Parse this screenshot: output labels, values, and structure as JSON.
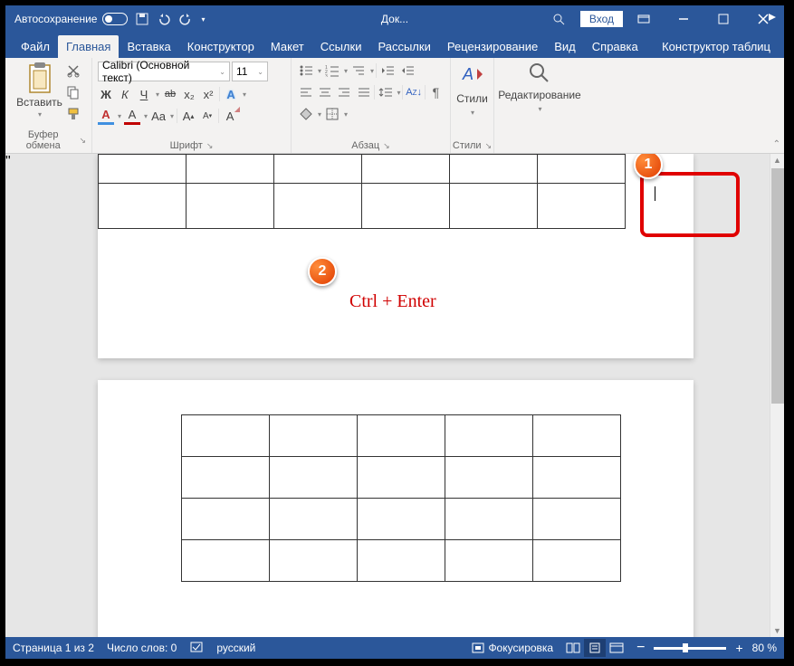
{
  "title_bar": {
    "autosave_label": "Автосохранение",
    "doc_title": "Док...",
    "login_label": "Вход"
  },
  "tabs": {
    "file": "Файл",
    "home": "Главная",
    "insert": "Вставка",
    "design": "Конструктор",
    "layout": "Макет",
    "references": "Ссылки",
    "mailings": "Рассылки",
    "review": "Рецензирование",
    "view": "Вид",
    "help": "Справка",
    "table_design": "Конструктор таблиц"
  },
  "ribbon": {
    "clipboard": {
      "paste": "Вставить",
      "label": "Буфер обмена"
    },
    "font": {
      "name": "Calibri (Основной текст)",
      "size": "11",
      "label": "Шрифт",
      "bold": "Ж",
      "italic": "К",
      "underline": "Ч",
      "strike": "ab",
      "sub": "x₂",
      "sup": "x²",
      "text_effect": "A",
      "highlight": "A",
      "font_color": "A",
      "case": "Aa",
      "clear": "A"
    },
    "paragraph": {
      "label": "Абзац"
    },
    "styles": {
      "label": "Стили",
      "btn": "Стили"
    },
    "editing": {
      "label": "",
      "btn": "Редактирование"
    }
  },
  "annotations": {
    "badge1": "1",
    "badge2": "2",
    "text": "Ctrl + Enter"
  },
  "status": {
    "page": "Страница 1 из 2",
    "words": "Число слов: 0",
    "lang": "русский",
    "focus": "Фокусировка",
    "zoom": "80 %",
    "minus": "−",
    "plus": "+"
  }
}
